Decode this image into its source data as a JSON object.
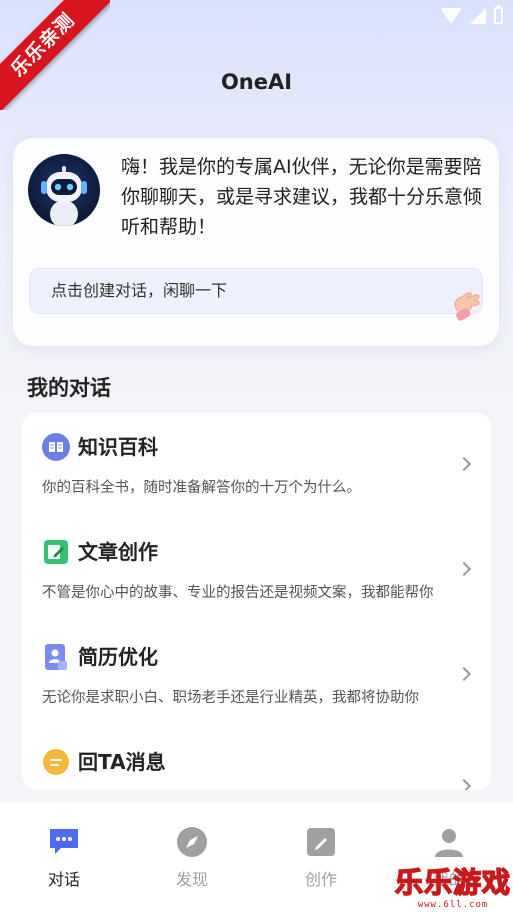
{
  "ribbon": {
    "text": "乐乐亲测"
  },
  "header": {
    "title": "OneAI"
  },
  "hero": {
    "greeting": "嗨！我是你的专属AI伙伴，无论你是需要陪你聊聊天，或是寻求建议，我都十分乐意倾听和帮助！",
    "chat_prompt": "点击创建对话，闲聊一下"
  },
  "section": {
    "title": "我的对话"
  },
  "conversations": [
    {
      "title": "知识百科",
      "desc": "你的百科全书，随时准备解答你的十万个为什么。",
      "icon": "book-icon",
      "color": "#6b7fe6"
    },
    {
      "title": "文章创作",
      "desc": "不管是你心中的故事、专业的报告还是视频文案，我都能帮你",
      "icon": "edit-icon",
      "color": "#35c06f"
    },
    {
      "title": "简历优化",
      "desc": "无论你是求职小白、职场老手还是行业精英，我都将协助你",
      "icon": "resume-icon",
      "color": "#6b7fe6"
    },
    {
      "title": "回TA消息",
      "desc": "",
      "icon": "message-icon",
      "color": "#f6b83a"
    }
  ],
  "tabs": [
    {
      "label": "对话",
      "icon": "chat-icon",
      "active": true
    },
    {
      "label": "发现",
      "icon": "compass-icon",
      "active": false
    },
    {
      "label": "创作",
      "icon": "create-icon",
      "active": false
    },
    {
      "label": "我的",
      "icon": "profile-icon",
      "active": false
    }
  ],
  "watermark": {
    "main": "乐乐游戏",
    "sub": "www.6ll.com"
  },
  "colors": {
    "accent": "#4d6bf2",
    "inactive": "#a0a0a0",
    "ribbon": "#d8141d"
  }
}
